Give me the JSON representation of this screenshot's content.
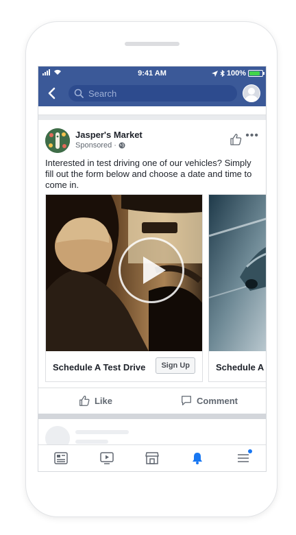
{
  "status_bar": {
    "time": "9:41 AM",
    "battery": "100%"
  },
  "nav": {
    "search_placeholder": "Search"
  },
  "post": {
    "page_name": "Jasper's Market",
    "sponsored_label": "Sponsored",
    "separator": "·",
    "text": "Interested in test driving one of our vehicles? Simply fill out the form below and choose a date and time to come in.",
    "carousel": [
      {
        "title": "Schedule A Test Drive",
        "button": "Sign Up"
      },
      {
        "title": "Schedule A T"
      }
    ],
    "actions": {
      "like": "Like",
      "comment": "Comment"
    }
  },
  "tabs": [
    "news-feed",
    "watch",
    "marketplace",
    "notifications",
    "menu"
  ],
  "colors": {
    "header": "#3b5998",
    "accent": "#1877f2",
    "text": "#1d2129",
    "muted": "#606770"
  },
  "icons": [
    "back-arrow-icon",
    "search-icon",
    "thumbs-up-icon",
    "more-icon",
    "globe-icon",
    "play-icon",
    "comment-icon",
    "news-feed-icon",
    "watch-icon",
    "marketplace-icon",
    "bell-icon",
    "menu-icon"
  ]
}
